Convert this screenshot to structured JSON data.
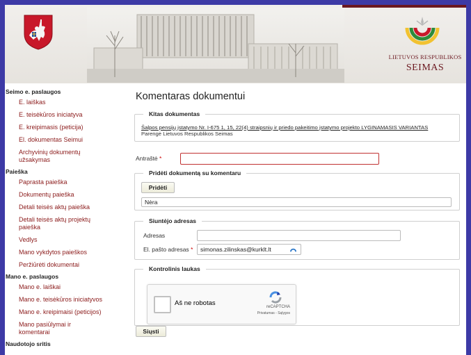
{
  "header": {
    "seimas_line1": "LIETUVOS RESPUBLIKOS",
    "seimas_line2": "SEIMAS",
    "accent": "#6b1820"
  },
  "sidebar": {
    "sections": [
      {
        "title": "Seimo e. paslaugos",
        "items": [
          "E. laiškas",
          "E. teisėkūros iniciatyva",
          "E. kreipimasis (peticija)",
          "El. dokumentas Seimui",
          "Archyvinių dokumentų užsakymas"
        ]
      },
      {
        "title": "Paieška",
        "items": [
          "Paprasta paieška",
          "Dokumentų paieška",
          "Detali teisės aktų paieška",
          "Detali teisės aktų projektų paieška",
          "Vedlys",
          "Mano vykdytos paieškos",
          "Peržiūrėti dokumentai"
        ]
      },
      {
        "title": "Mano e. paslaugos",
        "items": [
          "Mano e. laiškai",
          "Mano e. teisėkūros iniciatyvos",
          "Mano e. kreipimaisi (peticijos)",
          "Mano pasiūlymai ir komentarai"
        ]
      },
      {
        "title": "Naudotojo sritis",
        "items": []
      }
    ]
  },
  "main": {
    "title": "Komentaras dokumentui",
    "doc_section": {
      "legend": "Kitas dokumentas",
      "link": "Šalpos pensijų įstatymo Nr. I-675 1, 15, 22(4) straipsnių ir priedo pakeitimo įstatymo projekto LYGINAMASIS VARIANTAS",
      "sub": "Parengė Lietuvos Respublikos Seimas"
    },
    "title_field": {
      "label": "Antraštė",
      "required": "*",
      "value": ""
    },
    "attach_section": {
      "legend": "Pridėti dokumentą su komentaru",
      "button": "Pridėti",
      "value": "Nėra"
    },
    "sender_section": {
      "legend": "Siuntėjo adresas",
      "address_label": "Adresas",
      "address_value": "",
      "email_label": "El. pašto adresas",
      "email_required": "*",
      "email_value": "simonas.zilinskas@kurklt.lt"
    },
    "control_section": {
      "legend": "Kontrolinis laukas",
      "captcha_label": "Aš ne robotas",
      "captcha_brand": "reCAPTCHA",
      "captcha_terms": "Privatumas - Sąlygos"
    },
    "submit": "Siųsti"
  }
}
